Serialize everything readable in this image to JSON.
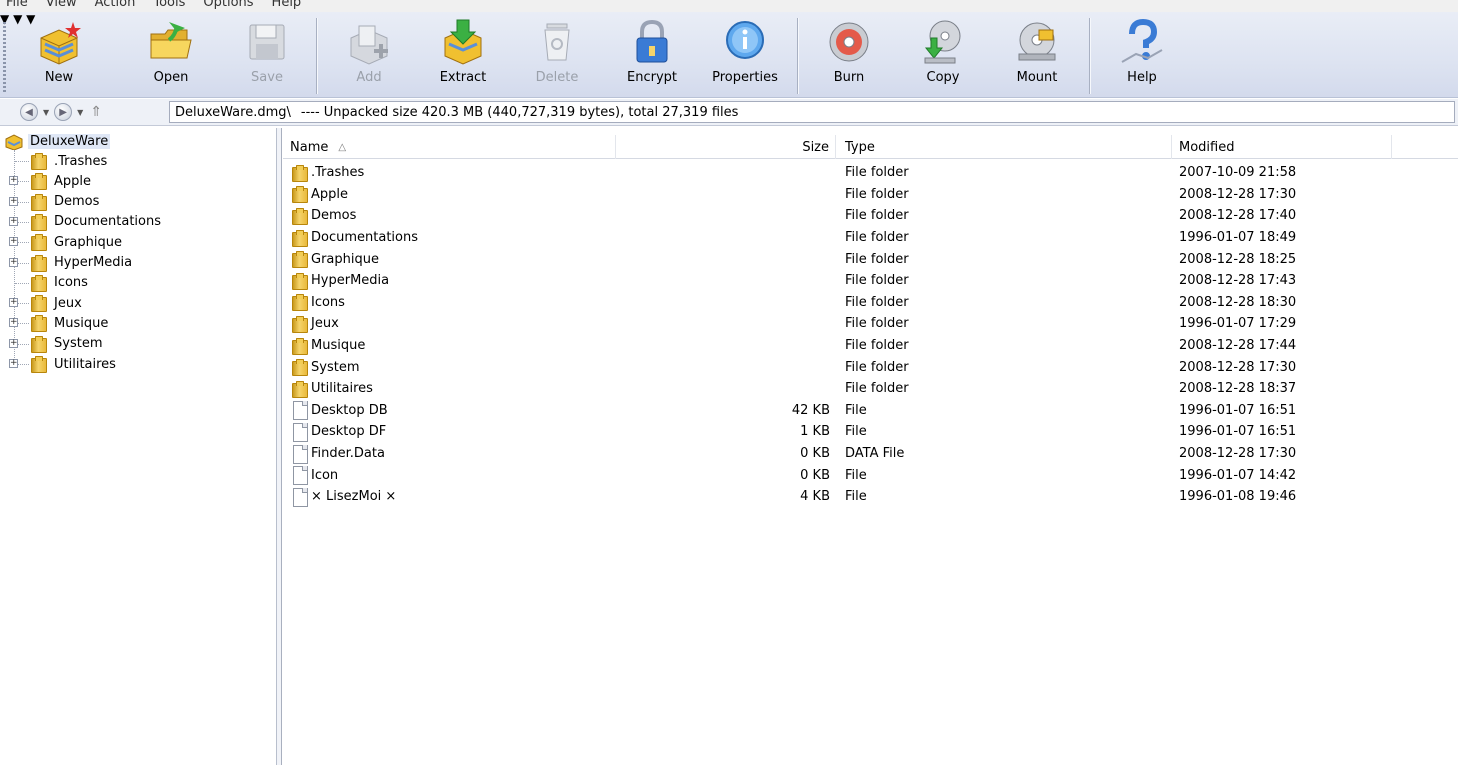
{
  "menu": [
    "File",
    "View",
    "Action",
    "Tools",
    "Options",
    "Help"
  ],
  "toolbar": {
    "new": "New",
    "open": "Open",
    "save": "Save",
    "add": "Add",
    "extract": "Extract",
    "delete": "Delete",
    "encrypt": "Encrypt",
    "properties": "Properties",
    "burn": "Burn",
    "copy": "Copy",
    "mount": "Mount",
    "help": "Help"
  },
  "address": {
    "path": "DeluxeWare.dmg\\",
    "info": "----   Unpacked size 420.3 MB (440,727,319 bytes), total 27,319 files"
  },
  "tree": {
    "root": "DeluxeWare",
    "items": [
      ".Trashes",
      "Apple",
      "Demos",
      "Documentations",
      "Graphique",
      "HyperMedia",
      "Icons",
      "Jeux",
      "Musique",
      "System",
      "Utilitaires"
    ]
  },
  "columns": {
    "name": "Name",
    "size": "Size",
    "type": "Type",
    "modified": "Modified"
  },
  "files": [
    {
      "name": ".Trashes",
      "size": "",
      "type": "File folder",
      "modified": "2007-10-09 21:58"
    },
    {
      "name": "Apple",
      "size": "",
      "type": "File folder",
      "modified": "2008-12-28 17:30"
    },
    {
      "name": "Demos",
      "size": "",
      "type": "File folder",
      "modified": "2008-12-28 17:40"
    },
    {
      "name": "Documentations",
      "size": "",
      "type": "File folder",
      "modified": "1996-01-07 18:49"
    },
    {
      "name": "Graphique",
      "size": "",
      "type": "File folder",
      "modified": "2008-12-28 18:25"
    },
    {
      "name": "HyperMedia",
      "size": "",
      "type": "File folder",
      "modified": "2008-12-28 17:43"
    },
    {
      "name": "Icons",
      "size": "",
      "type": "File folder",
      "modified": "2008-12-28 18:30"
    },
    {
      "name": "Jeux",
      "size": "",
      "type": "File folder",
      "modified": "1996-01-07 17:29"
    },
    {
      "name": "Musique",
      "size": "",
      "type": "File folder",
      "modified": "2008-12-28 17:44"
    },
    {
      "name": "System",
      "size": "",
      "type": "File folder",
      "modified": "2008-12-28 17:30"
    },
    {
      "name": "Utilitaires",
      "size": "",
      "type": "File folder",
      "modified": "2008-12-28 18:37"
    },
    {
      "name": "Desktop DB",
      "size": "42 KB",
      "type": "File",
      "modified": "1996-01-07 16:51"
    },
    {
      "name": "Desktop DF",
      "size": "1 KB",
      "type": "File",
      "modified": "1996-01-07 16:51"
    },
    {
      "name": "Finder.Data",
      "size": "0 KB",
      "type": "DATA File",
      "modified": "2008-12-28 17:30"
    },
    {
      "name": "Icon",
      "size": "0 KB",
      "type": "File",
      "modified": "1996-01-07 14:42"
    },
    {
      "name": "× LisezMoi ×",
      "size": "4 KB",
      "type": "File",
      "modified": "1996-01-08 19:46"
    }
  ]
}
